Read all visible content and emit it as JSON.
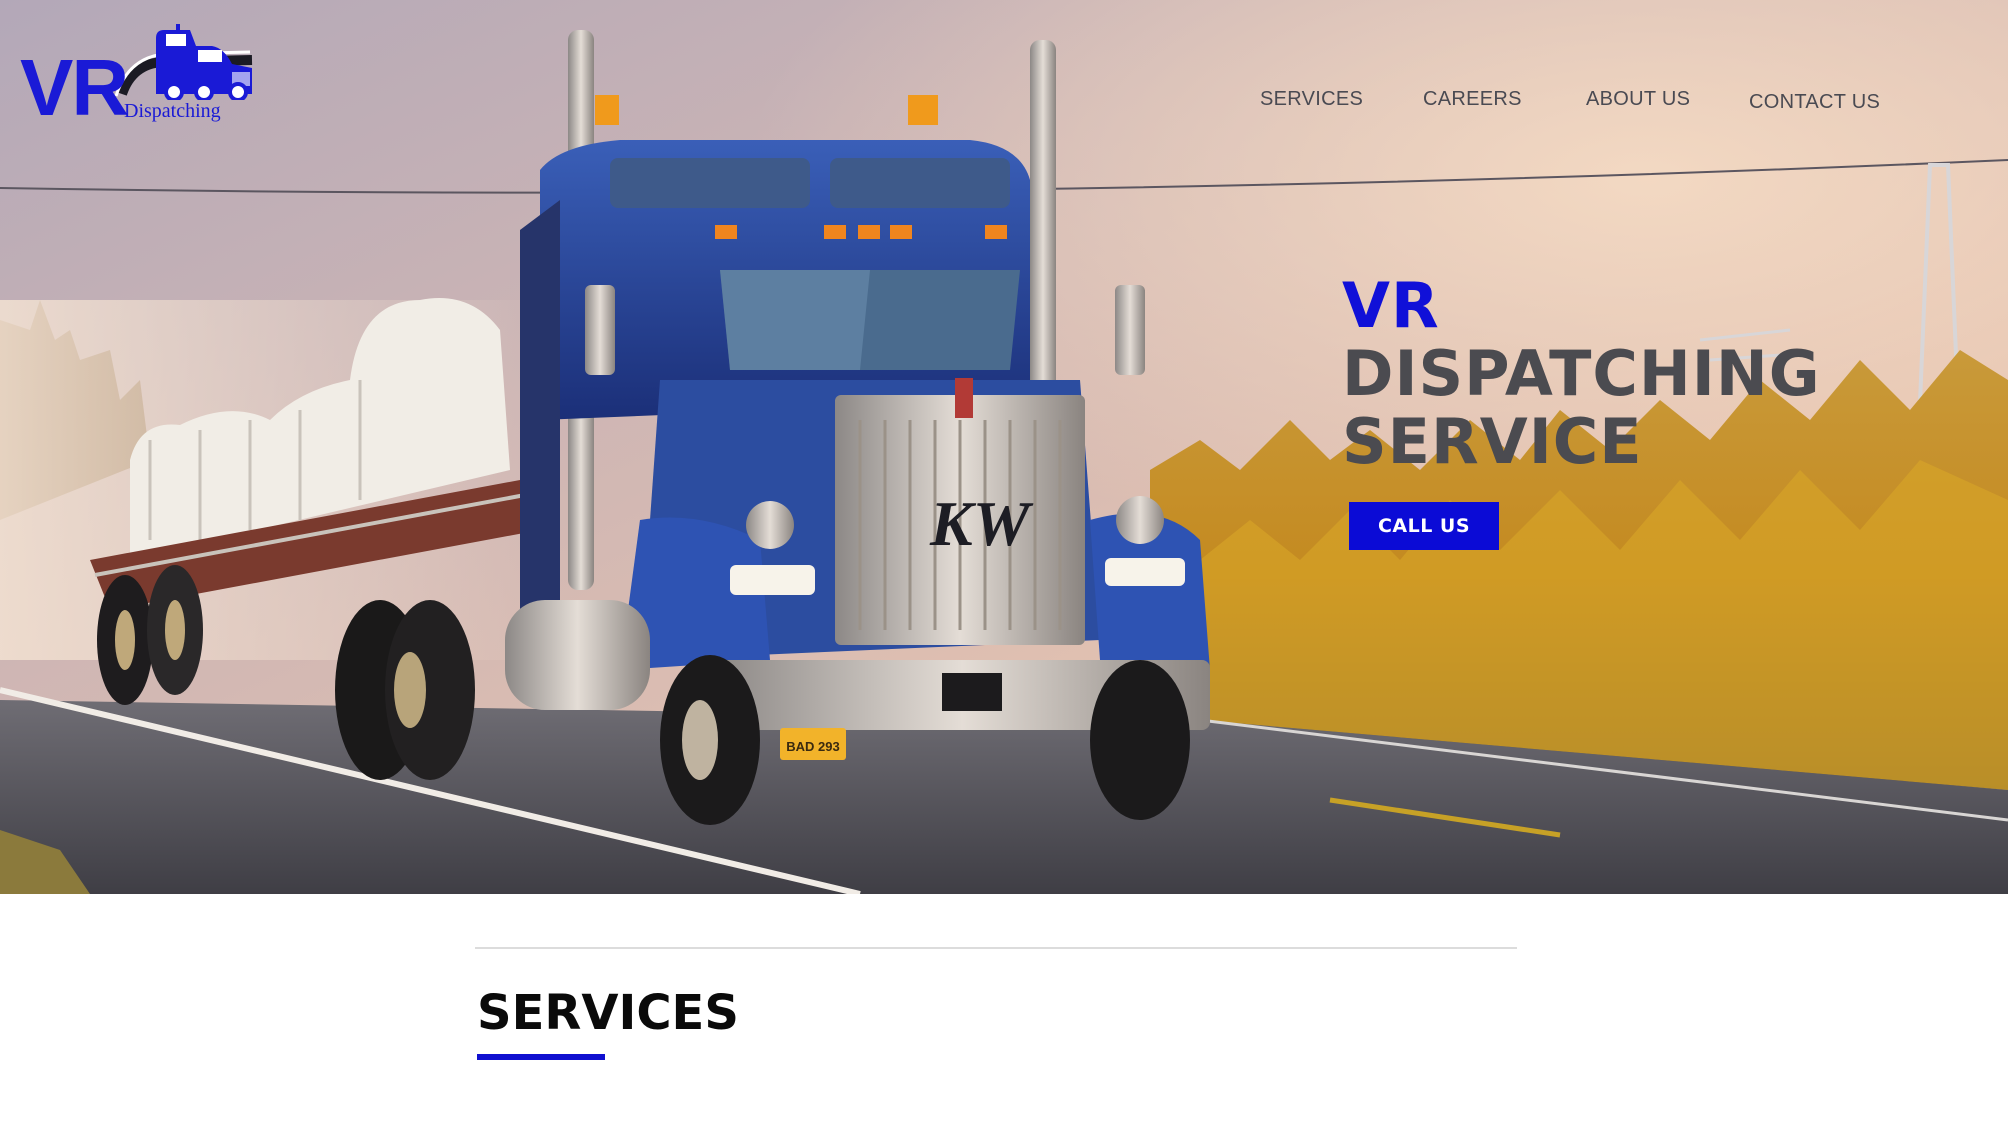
{
  "header": {
    "logo": {
      "mark": "VR",
      "sub": "Dispatching"
    },
    "nav": [
      {
        "label": "SERVICES"
      },
      {
        "label": "CAREERS"
      },
      {
        "label": "ABOUT US"
      },
      {
        "label": "CONTACT US"
      }
    ]
  },
  "hero": {
    "title_line1": "VR",
    "title_line2": "DISPATCHING",
    "title_line3": "SERVICE",
    "cta_label": "CALL US",
    "plate": "BAD 293",
    "grille_badge": "KW"
  },
  "services": {
    "heading": "SERVICES"
  },
  "colors": {
    "brand_blue": "#1010d8",
    "button_blue": "#0b0bd6",
    "heading_gray": "#4b4b50",
    "nav_gray": "#4a4a52"
  },
  "icons": {
    "logo_truck": "truck-icon"
  }
}
